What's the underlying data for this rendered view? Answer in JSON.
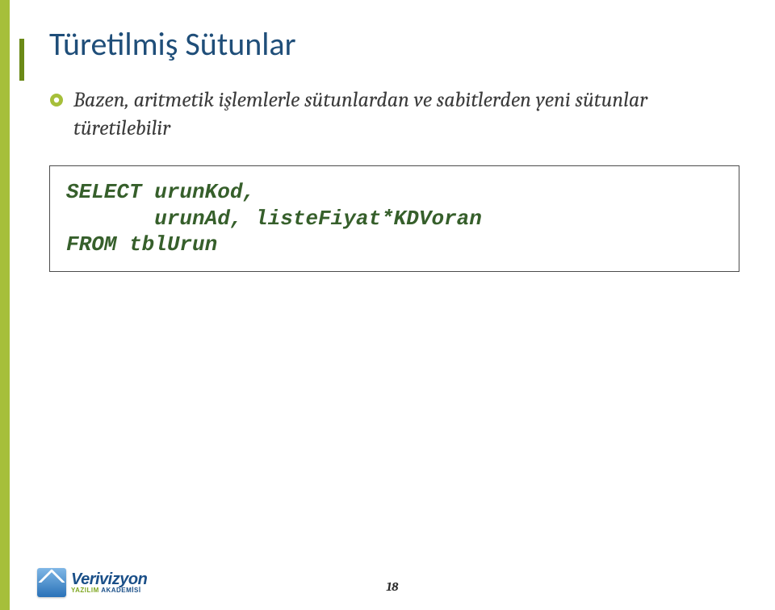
{
  "title": "Türetilmiş Sütunlar",
  "bullet": "Bazen, aritmetik işlemlerle sütunlardan ve sabitlerden yeni sütunlar türetilebilir",
  "code": "SELECT urunKod,\n       urunAd, listeFiyat*KDVoran\nFROM tblUrun",
  "pageNumber": "18",
  "logo": {
    "brand": "Verivizyon",
    "subPrefix": "YAZILIM",
    "subSuffix": " AKADEMİSİ"
  }
}
